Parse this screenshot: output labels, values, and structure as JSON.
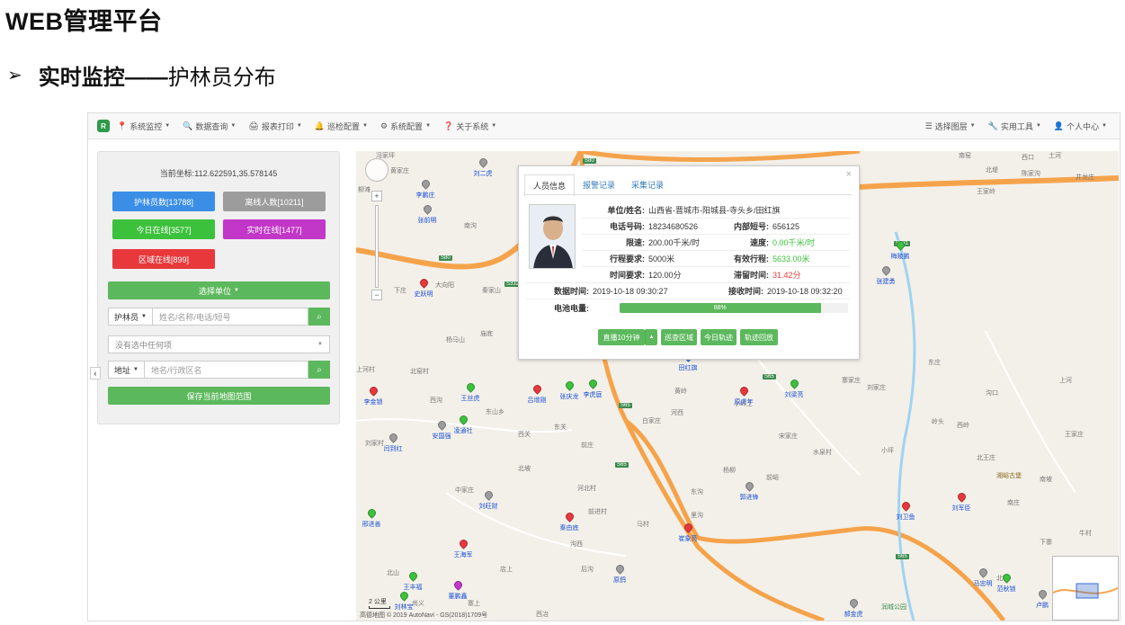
{
  "slide": {
    "title": "WEB管理平台",
    "bullet": "➢",
    "subtitle_bold": "实时监控——",
    "subtitle_rest": "护林员分布"
  },
  "navbar": {
    "logo": "R",
    "left": [
      {
        "icon": "📍",
        "label": "系统监控"
      },
      {
        "icon": "🔍",
        "label": "数据查询"
      },
      {
        "icon": "🖨",
        "label": "报表打印"
      },
      {
        "icon": "🔔",
        "label": "巡检配置"
      },
      {
        "icon": "⚙",
        "label": "系统配置"
      },
      {
        "icon": "❓",
        "label": "关于系统"
      }
    ],
    "right": [
      {
        "icon": "☰",
        "label": "选择图层"
      },
      {
        "icon": "🔧",
        "label": "实用工具"
      },
      {
        "icon": "👤",
        "label": "个人中心"
      }
    ]
  },
  "panel": {
    "coord": "当前坐标:112.622591,35.578145",
    "stats": {
      "rangers": "护林员数[13788]",
      "offline": "离线人数[10211]",
      "today_online": "今日在线[3577]",
      "realtime_online": "实时在线[1477]",
      "area_online": "区域在线[899]"
    },
    "select_unit": "选择单位",
    "ranger_addon": "护林员",
    "ranger_placeholder": "姓名/名称/电话/短号",
    "select_none": "没有选中任何项",
    "address_addon": "地址",
    "address_placeholder": "地名/行政区名",
    "save_range": "保存当前地图范围"
  },
  "colors": {
    "blue": "#3a8ee6",
    "gray": "#9c9c9c",
    "green": "#3cc13c",
    "magenta": "#c236c8",
    "red": "#e8383c",
    "primary": "#5cb85c"
  },
  "popup": {
    "tabs": [
      "人员信息",
      "报警记录",
      "采集记录"
    ],
    "unit_label": "单位/姓名:",
    "unit_value": "山西省-晋城市-阳城县-寺头乡/田红旗",
    "phone_label": "电话号码:",
    "phone_value": "18234680526",
    "short_label": "内部短号:",
    "short_value": "656125",
    "limit_label": "限速:",
    "limit_value": "200.00千米/时",
    "speed_label": "速度:",
    "speed_value": "0.00千米/时",
    "trip_req_label": "行程要求:",
    "trip_req_value": "5000米",
    "trip_eff_label": "有效行程:",
    "trip_eff_value": "5633.00米",
    "time_req_label": "时间要求:",
    "time_req_value": "120.00分",
    "stay_label": "滞留时间:",
    "stay_value": "31.42分",
    "data_time_label": "数据时间:",
    "data_time_value": "2019-10-18 09:30:27",
    "recv_time_label": "接收时间:",
    "recv_time_value": "2019-10-18 09:32:20",
    "battery_label": "电池电量:",
    "battery_value": "88%",
    "battery_level": 88,
    "buttons": {
      "track": "直播10分钟",
      "patrol": "巡查区域",
      "today": "今日轨迹",
      "replay": "轨迹回放"
    }
  },
  "map": {
    "scale": "2 公里",
    "copyright": "高德地图 © 2019 AutoNavi - GS(2018)1709号",
    "places": [
      "冯家坪",
      "黄家庄",
      "柳滩",
      "土河",
      "陈家沟",
      "井龙庄",
      "南窑",
      "北堤",
      "西口",
      "王家岭",
      "下庄",
      "大向阳",
      "秦家山",
      "南沟",
      "杨马山",
      "庙底",
      "上河村",
      "北窑村",
      "西沟",
      "东山乡",
      "西关",
      "东关",
      "河北村",
      "刘家村",
      "前庄",
      "白家庄",
      "中家庄",
      "北坡",
      "前进村",
      "沟西",
      "店上",
      "北山",
      "寨上",
      "尚义",
      "西冶",
      "后沟",
      "马村",
      "黄岭",
      "河西",
      "东沟",
      "杨柳",
      "前峪",
      "里沟",
      "小岭上",
      "宋家庄",
      "水泉村",
      "寨家庄",
      "刘家庄",
      "小坪",
      "岭头",
      "西岭",
      "沟口",
      "东庄",
      "北王庄",
      "南庄",
      "南坡",
      "上河",
      "王家庄",
      "牛村",
      "西北",
      "北坪",
      "下寨"
    ],
    "roads": [
      "S80",
      "S80",
      "S332",
      "S65",
      "S65",
      "S65",
      "S65",
      "S331"
    ],
    "markers": [
      {
        "name": "刘二虎",
        "color": "#9c9c9c"
      },
      {
        "name": "李鹏庄",
        "color": "#9c9c9c"
      },
      {
        "name": "张前明",
        "color": "#9c9c9c"
      },
      {
        "name": "史跃明",
        "color": "#e8383c"
      },
      {
        "name": "田红旗",
        "color": "#3a8ee6"
      },
      {
        "name": "李金锁",
        "color": "#e8383c"
      },
      {
        "name": "王丝虎",
        "color": "#3cc13c"
      },
      {
        "name": "吕增刚",
        "color": "#e8383c"
      },
      {
        "name": "张庆龙",
        "color": "#3cc13c"
      },
      {
        "name": "李虎庭",
        "color": "#3cc13c"
      },
      {
        "name": "原虎年",
        "color": "#e8383c"
      },
      {
        "name": "刘梁亮",
        "color": "#3cc13c"
      },
      {
        "name": "安国强",
        "color": "#9c9c9c"
      },
      {
        "name": "凌通社",
        "color": "#3cc13c"
      },
      {
        "name": "闫到红",
        "color": "#9c9c9c"
      },
      {
        "name": "刘旺财",
        "color": "#9c9c9c"
      },
      {
        "name": "郭进锋",
        "color": "#9c9c9c"
      },
      {
        "name": "秦由底",
        "color": "#e8383c"
      },
      {
        "name": "崔象亮",
        "color": "#e8383c"
      },
      {
        "name": "王海军",
        "color": "#e8383c"
      },
      {
        "name": "邢进善",
        "color": "#3cc13c"
      },
      {
        "name": "王丰福",
        "color": "#3cc13c"
      },
      {
        "name": "刘林宝",
        "color": "#3cc13c"
      },
      {
        "name": "董鹏鑫",
        "color": "#c236c8"
      },
      {
        "name": "原鸽",
        "color": "#9c9c9c"
      },
      {
        "name": "郝金虎",
        "color": "#9c9c9c"
      },
      {
        "name": "刘卫鱼",
        "color": "#e8383c"
      },
      {
        "name": "刘军臣",
        "color": "#e8383c"
      },
      {
        "name": "马忠明",
        "color": "#9c9c9c"
      },
      {
        "name": "范秋锁",
        "color": "#3cc13c"
      },
      {
        "name": "卢鹏",
        "color": "#9c9c9c"
      },
      {
        "name": "张建勇",
        "color": "#9c9c9c"
      },
      {
        "name": "梅陵鹏",
        "color": "#3cc13c"
      }
    ],
    "pois": [
      "湘峪古堡",
      "润城公园"
    ]
  }
}
